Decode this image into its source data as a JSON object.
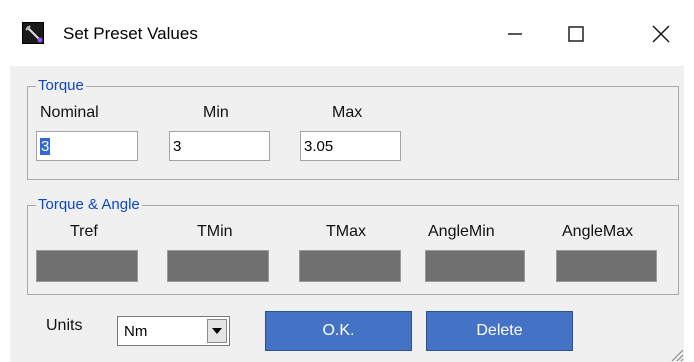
{
  "window": {
    "title": "Set Preset Values",
    "icon": "app-wrench-icon",
    "controls": {
      "minimize": "minimize-icon",
      "maximize": "maximize-icon",
      "close": "close-icon"
    }
  },
  "torque": {
    "legend": "Torque",
    "nominal_label": "Nominal",
    "min_label": "Min",
    "max_label": "Max",
    "nominal_value": "3",
    "min_value": "3",
    "max_value": "3.05"
  },
  "torque_angle": {
    "legend": "Torque & Angle",
    "columns": [
      "Tref",
      "TMin",
      "TMax",
      "AngleMin",
      "AngleMax"
    ]
  },
  "units": {
    "label": "Units",
    "selected": "Nm"
  },
  "buttons": {
    "ok": "O.K.",
    "delete": "Delete"
  },
  "colors": {
    "legend": "#0d47c4",
    "button": "#4472c4",
    "disabled_field": "#707070",
    "selection": "#3367d6"
  }
}
